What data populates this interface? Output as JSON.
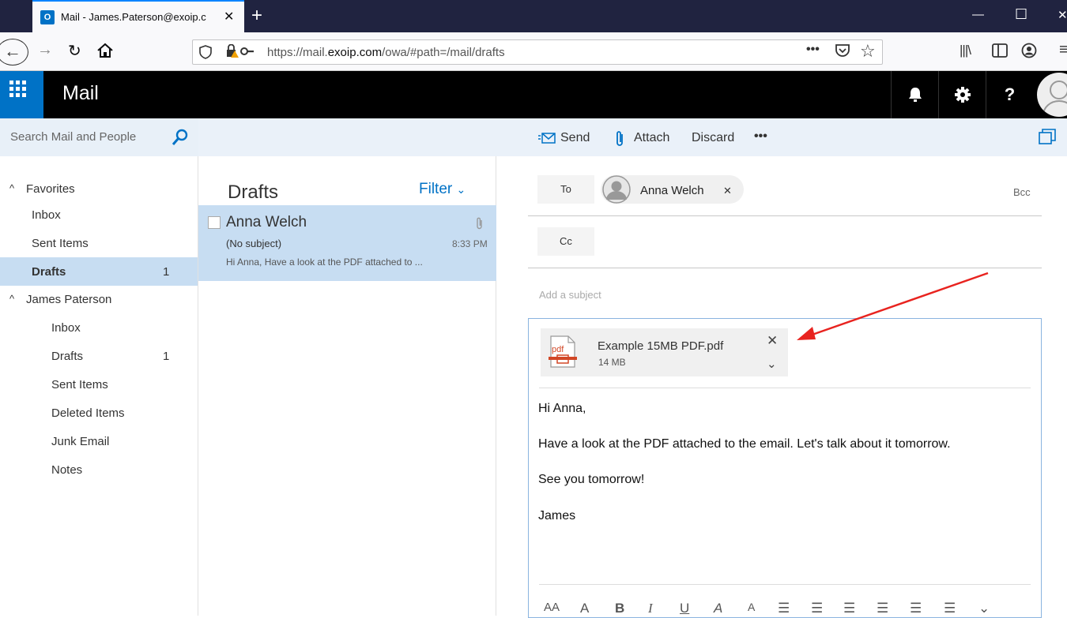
{
  "browser": {
    "tab_title": "Mail - James.Paterson@exoip.c",
    "tab_icon": "O",
    "url_prefix": "https://mail.",
    "url_domain": "exoip.com",
    "url_path": "/owa/#path=/mail/drafts"
  },
  "app": {
    "title": "Mail",
    "help_glyph": "?"
  },
  "search": {
    "placeholder": "Search Mail and People"
  },
  "toolbar": {
    "send": "Send",
    "attach": "Attach",
    "discard": "Discard",
    "more": "•••"
  },
  "nav": {
    "favorites_header": "Favorites",
    "favorites": [
      {
        "label": "Inbox",
        "count": ""
      },
      {
        "label": "Sent Items",
        "count": ""
      },
      {
        "label": "Drafts",
        "count": "1"
      }
    ],
    "account_header": "James Paterson",
    "folders": [
      {
        "label": "Inbox",
        "count": ""
      },
      {
        "label": "Drafts",
        "count": "1"
      },
      {
        "label": "Sent Items",
        "count": ""
      },
      {
        "label": "Deleted Items",
        "count": ""
      },
      {
        "label": "Junk Email",
        "count": ""
      },
      {
        "label": "Notes",
        "count": ""
      }
    ]
  },
  "list": {
    "title": "Drafts",
    "filter": "Filter",
    "messages": [
      {
        "sender": "Anna Welch",
        "subject": "(No subject)",
        "time": "8:33 PM",
        "preview": "Hi Anna, Have a look at the PDF attached to ..."
      }
    ]
  },
  "compose": {
    "to_label": "To",
    "cc_label": "Cc",
    "bcc_label": "Bcc",
    "recipient": "Anna Welch",
    "subject_placeholder": "Add a subject",
    "attachment": {
      "name": "Example 15MB PDF.pdf",
      "size": "14 MB",
      "type_label": "pdf"
    },
    "body": [
      "Hi Anna,",
      "Have a look at the PDF attached to the email. Let's talk about it tomorrow.",
      "See you tomorrow!",
      "James"
    ]
  },
  "colors": {
    "accent": "#0072c6",
    "selection": "#c7ddf2",
    "annotation_arrow": "#e8231f"
  }
}
